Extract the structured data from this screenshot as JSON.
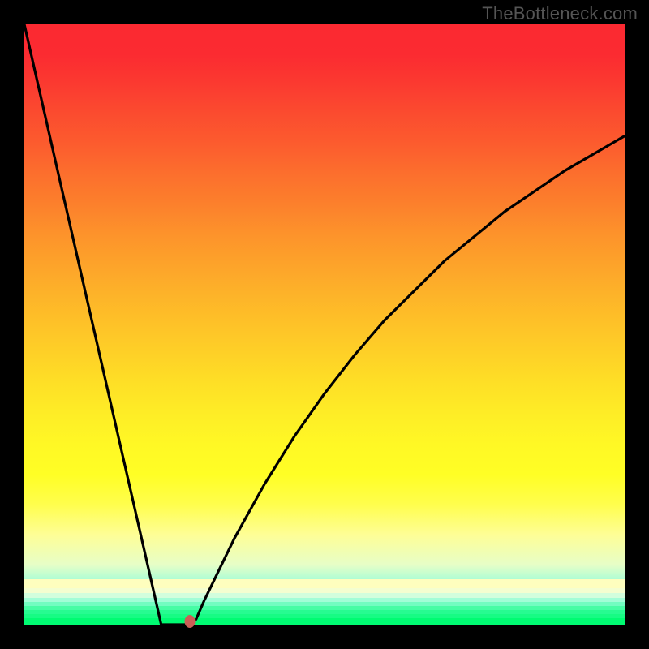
{
  "watermark": "TheBottleneck.com",
  "chart_data": {
    "type": "line",
    "title": "",
    "xlabel": "",
    "ylabel": "",
    "xlim": [
      0,
      1
    ],
    "ylim": [
      0,
      1
    ],
    "grid": false,
    "series": [
      {
        "name": "curve",
        "x": [
          0.0,
          0.05,
          0.1,
          0.15,
          0.2,
          0.228,
          0.25,
          0.27,
          0.286,
          0.3,
          0.35,
          0.4,
          0.45,
          0.5,
          0.55,
          0.6,
          0.7,
          0.8,
          0.9,
          1.0
        ],
        "y": [
          1.0,
          0.78,
          0.561,
          0.342,
          0.123,
          0.0,
          0.0,
          0.0,
          0.009,
          0.041,
          0.144,
          0.234,
          0.314,
          0.385,
          0.449,
          0.507,
          0.606,
          0.688,
          0.756,
          0.814
        ]
      }
    ],
    "marker": {
      "x": 0.275,
      "y": 0.005
    },
    "background_gradient": {
      "top": "#fb2931",
      "middle_upper": "#fc802c",
      "middle": "#fec228",
      "middle_lower": "#fffe25",
      "near_bottom": "#fefebe",
      "bottom": "#00fb72"
    }
  }
}
